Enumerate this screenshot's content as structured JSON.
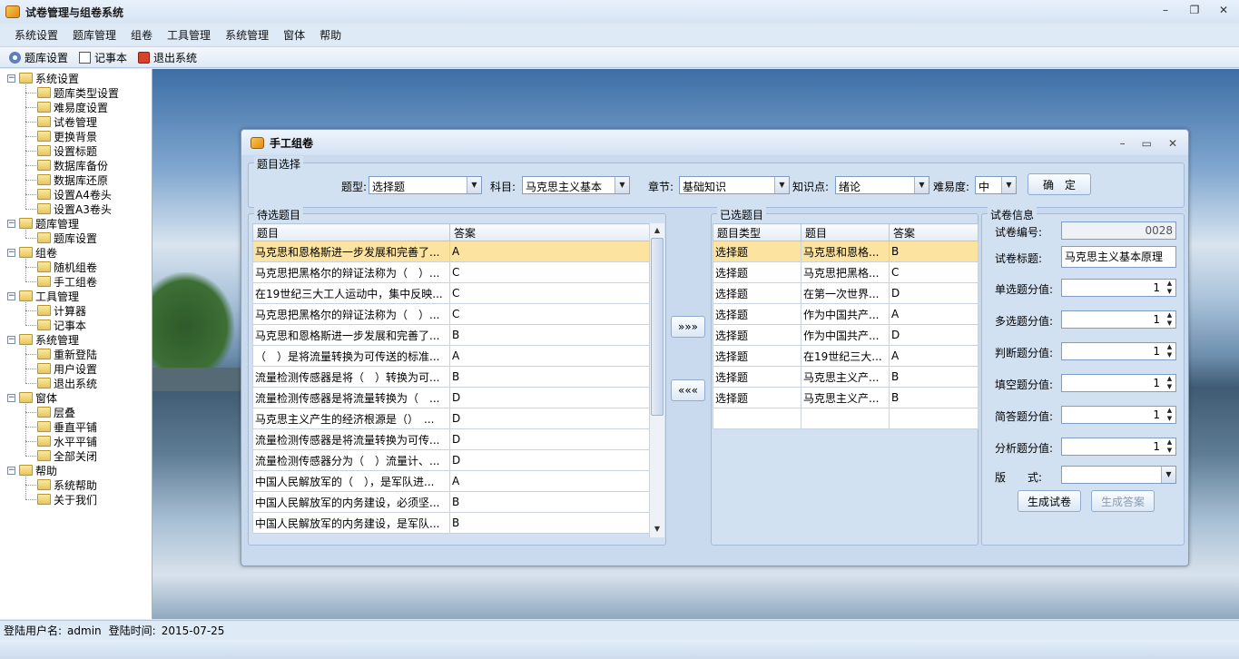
{
  "app": {
    "title": "试卷管理与组卷系统"
  },
  "menubar": [
    "系统设置",
    "题库管理",
    "组卷",
    "工具管理",
    "系统管理",
    "窗体",
    "帮助"
  ],
  "toolbar": {
    "items": [
      {
        "label": "题库设置",
        "icon": "gear-icon"
      },
      {
        "label": "记事本",
        "icon": "notepad-icon"
      },
      {
        "label": "退出系统",
        "icon": "exit-icon"
      }
    ]
  },
  "tree": [
    {
      "label": "系统设置",
      "children": [
        "题库类型设置",
        "难易度设置",
        "试卷管理",
        "更换背景",
        "设置标题",
        "数据库备份",
        "数据库还原",
        "设置A4卷头",
        "设置A3卷头"
      ]
    },
    {
      "label": "题库管理",
      "children": [
        "题库设置"
      ]
    },
    {
      "label": "组卷",
      "children": [
        "随机组卷",
        "手工组卷"
      ]
    },
    {
      "label": "工具管理",
      "children": [
        "计算器",
        "记事本"
      ]
    },
    {
      "label": "系统管理",
      "children": [
        "重新登陆",
        "用户设置",
        "退出系统"
      ]
    },
    {
      "label": "窗体",
      "children": [
        "层叠",
        "垂直平铺",
        "水平平铺",
        "全部关闭"
      ]
    },
    {
      "label": "帮助",
      "children": [
        "系统帮助",
        "关于我们"
      ]
    }
  ],
  "dialog": {
    "title": "手工组卷",
    "filter": {
      "group_label": "题目选择",
      "type_label": "题型:",
      "type_value": "选择题",
      "subject_label": "科目:",
      "subject_value": "马克思主义基本",
      "chapter_label": "章节:",
      "chapter_value": "基础知识",
      "point_label": "知识点:",
      "point_value": "绪论",
      "difficulty_label": "难易度:",
      "difficulty_value": "中",
      "confirm_button": "确　定"
    },
    "pending": {
      "group_label": "待选题目",
      "columns": [
        "题目",
        "答案"
      ],
      "rows": [
        [
          "马克思和恩格斯进一步发展和完善了...",
          "A"
        ],
        [
          "马克思把黑格尔的辩证法称为（　）...",
          "C"
        ],
        [
          "在19世纪三大工人运动中，集中反映...",
          "C"
        ],
        [
          "马克思把黑格尔的辩证法称为（　）...",
          "C"
        ],
        [
          "马克思和恩格斯进一步发展和完善了...",
          "B"
        ],
        [
          "（　）是将流量转换为可传送的标准...",
          "A"
        ],
        [
          "流量检测传感器是将（　）转换为可...",
          "B"
        ],
        [
          "流量检测传感器是将流量转换为（　...",
          "D"
        ],
        [
          "马克思主义产生的经济根源是（）　...",
          "D"
        ],
        [
          "流量检测传感器是将流量转换为可传...",
          "D"
        ],
        [
          "流量检测传感器分为（　）流量计、...",
          "D"
        ],
        [
          "中国人民解放军的（　），是军队进...",
          "A"
        ],
        [
          "中国人民解放军的内务建设，必须坚...",
          "B"
        ],
        [
          "中国人民解放军的内务建设，是军队...",
          "B"
        ]
      ],
      "selected_index": 0
    },
    "move_right": "»»»",
    "move_left": "«««",
    "chosen": {
      "group_label": "已选题目",
      "columns": [
        "题目类型",
        "题目",
        "答案"
      ],
      "rows": [
        [
          "选择题",
          "马克思和恩格...",
          "B"
        ],
        [
          "选择题",
          "马克思把黑格...",
          "C"
        ],
        [
          "选择题",
          "在第一次世界...",
          "D"
        ],
        [
          "选择题",
          "作为中国共产...",
          "A"
        ],
        [
          "选择题",
          "作为中国共产...",
          "D"
        ],
        [
          "选择题",
          "在19世纪三大...",
          "A"
        ],
        [
          "选择题",
          "马克思主义产...",
          "B"
        ],
        [
          "选择题",
          "马克思主义产...",
          "B"
        ],
        [
          "",
          "",
          ""
        ]
      ],
      "selected_index": 0
    },
    "paper": {
      "group_label": "试卷信息",
      "id_label": "试卷编号:",
      "id_value": "0028",
      "title_label": "试卷标题:",
      "title_value": "马克思主义基本原理",
      "scores": [
        {
          "label": "单选题分值:",
          "value": "1"
        },
        {
          "label": "多选题分值:",
          "value": "1"
        },
        {
          "label": "判断题分值:",
          "value": "1"
        },
        {
          "label": "填空题分值:",
          "value": "1"
        },
        {
          "label": "简答题分值:",
          "value": "1"
        },
        {
          "label": "分析题分值:",
          "value": "1"
        }
      ],
      "format_label": "版　　式:",
      "format_value": "",
      "generate_paper": "生成试卷",
      "generate_answer": "生成答案"
    }
  },
  "status": {
    "user_label": "登陆用户名:",
    "user": "admin",
    "time_label": "登陆时间:",
    "time": "2015-07-25"
  }
}
